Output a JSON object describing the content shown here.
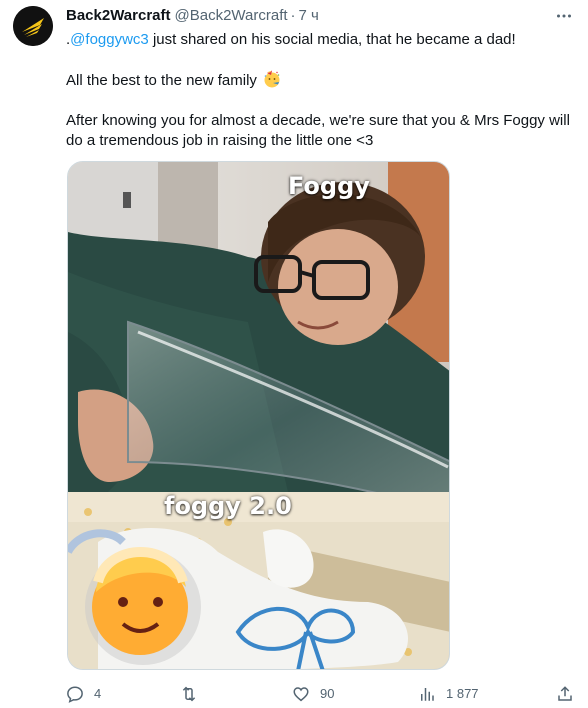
{
  "author": {
    "display_name": "Back2Warcraft",
    "handle": "@Back2Warcraft",
    "separator": "·",
    "timestamp": "7 ч",
    "avatar_icon": "back2warcraft-logo",
    "accent_color": "#f5c518"
  },
  "tweet": {
    "line1_prefix": ".",
    "mention": "@foggywc3",
    "line1_rest": " just shared on his social media, that he became a dad!",
    "line2": "All the best to the new family ",
    "line2_emoji": "party-face-emoji",
    "line3": "After knowing you for almost a decade, we're sure that you & Mrs Foggy will do a tremendous job in raising the little one <3",
    "mention_color": "#1d9bf0"
  },
  "media": {
    "caption_top": "Foggy",
    "caption_bottom": "foggy 2.0",
    "sticker_icon": "baby-emoji"
  },
  "actions": {
    "reply_count": "4",
    "retweet_count": "",
    "like_count": "90",
    "views_count": "1 877"
  }
}
